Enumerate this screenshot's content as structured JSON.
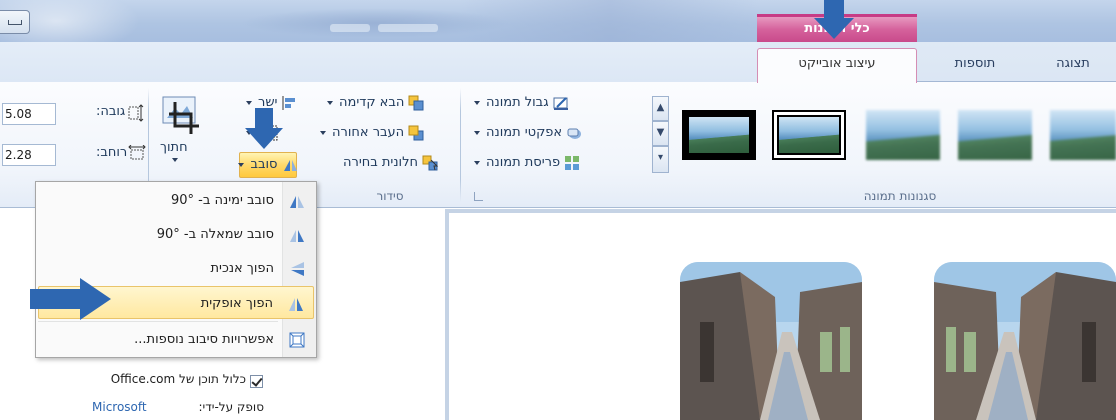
{
  "title_bar": {
    "contextual_tab_header": "כלי תמונות"
  },
  "tabs": [
    {
      "label": "עיצוב אובייקט",
      "active": true
    },
    {
      "label": "תוספות",
      "active": false
    },
    {
      "label": "תצוגה",
      "active": false
    }
  ],
  "ribbon": {
    "picture_styles": {
      "group_label": "סגנונות תמונה",
      "picture_border": "גבול תמונה",
      "picture_effects": "אפקטי תמונה",
      "picture_layout": "פריסת תמונה"
    },
    "arrange": {
      "group_label": "סידור",
      "bring_forward": "הבא קדימה",
      "send_backward": "העבר אחורה",
      "selection_pane": "חלונית בחירה",
      "align": "ישר",
      "rotate": "סובב"
    },
    "size": {
      "crop": "חתוך",
      "height_label": "גובה:",
      "height_value": "5.08",
      "width_label": "רוחב:",
      "width_value": "2.28"
    }
  },
  "rotate_menu": {
    "items": [
      {
        "label": "סובב ימינה ב- 90°",
        "icon": "rotate-right-icon",
        "highlighted": false
      },
      {
        "label": "סובב שמאלה ב- 90°",
        "icon": "rotate-left-icon",
        "highlighted": false
      },
      {
        "label": "הפוך אנכית",
        "icon": "flip-vertical-icon",
        "highlighted": false
      },
      {
        "label": "הפוך אופקית",
        "icon": "flip-horizontal-icon",
        "highlighted": true
      },
      {
        "label": "אפשרויות סיבוב נוספות...",
        "icon": "more-rotation-icon",
        "highlighted": false
      }
    ]
  },
  "left_pane": {
    "office_content_label": "כלול תוכן של Office.com",
    "provided_by_label": "סופק על-ידי:",
    "provider": "Microsoft"
  },
  "colors": {
    "accent": "#2e67b1",
    "contextual": "#d5629c",
    "highlight": "#ffd96b"
  }
}
